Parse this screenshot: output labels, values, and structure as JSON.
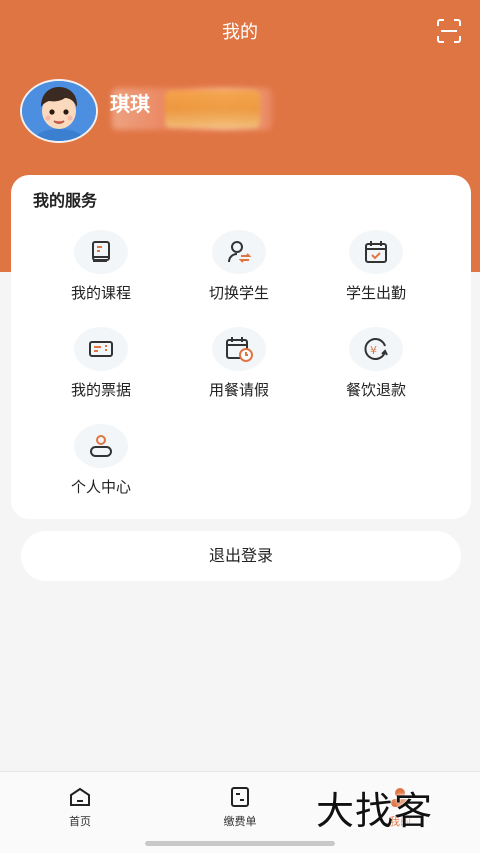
{
  "header": {
    "title": "我的",
    "scan_icon": "scan-icon"
  },
  "user": {
    "name": "琪琪",
    "avatar_icon": "boy-avatar"
  },
  "services": {
    "title": "我的服务",
    "items": [
      {
        "label": "我的课程",
        "icon": "book-icon"
      },
      {
        "label": "切换学生",
        "icon": "switch-user-icon"
      },
      {
        "label": "学生出勤",
        "icon": "calendar-check-icon"
      },
      {
        "label": "我的票据",
        "icon": "ticket-icon"
      },
      {
        "label": "用餐请假",
        "icon": "calendar-clock-icon"
      },
      {
        "label": "餐饮退款",
        "icon": "refund-yuan-icon"
      },
      {
        "label": "个人中心",
        "icon": "person-icon"
      }
    ]
  },
  "logout": {
    "label": "退出登录"
  },
  "tabbar": {
    "tabs": [
      {
        "label": "首页",
        "icon": "home-icon"
      },
      {
        "label": "缴费单",
        "icon": "bill-icon"
      },
      {
        "label": "我的",
        "icon": "user-icon"
      }
    ],
    "active": "我的"
  },
  "watermark": "大找客",
  "colors": {
    "brand": "#e07544",
    "background": "#f5f5f6",
    "card": "#ffffff",
    "icon_bg": "#f3f6f8"
  }
}
